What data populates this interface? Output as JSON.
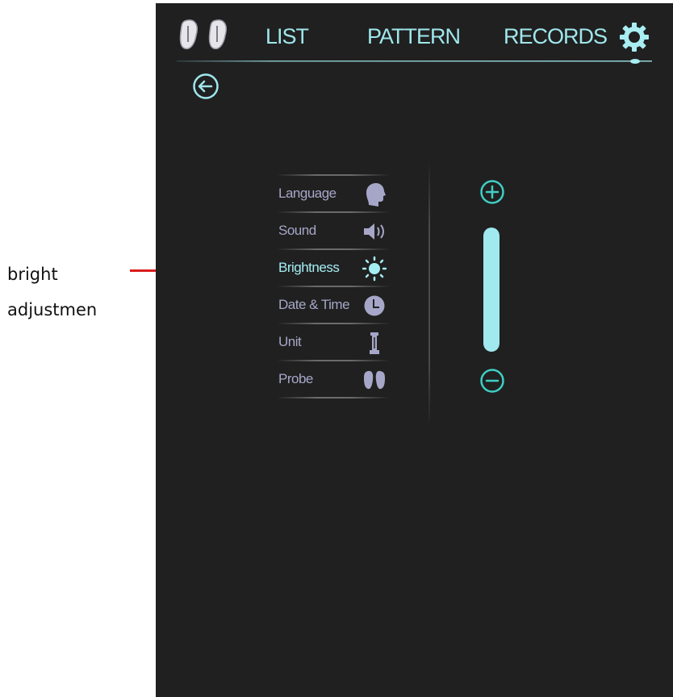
{
  "annotation": {
    "lines": [
      "bright",
      "adjustmen"
    ],
    "pointer_color": "#d91c1c"
  },
  "header": {
    "logo_icon": "probe-pair-icon",
    "tabs": [
      {
        "label": "LIST"
      },
      {
        "label": "PATTERN"
      },
      {
        "label": "RECORDS"
      }
    ],
    "settings_icon": "gear-icon",
    "back_icon": "back-arrow-icon"
  },
  "settings_menu": {
    "items": [
      {
        "label": "Language",
        "icon": "head-icon",
        "active": false
      },
      {
        "label": "Sound",
        "icon": "speaker-icon",
        "active": false
      },
      {
        "label": "Brightness",
        "icon": "sun-icon",
        "active": true
      },
      {
        "label": "Date & Time",
        "icon": "clock-icon",
        "active": false
      },
      {
        "label": "Unit",
        "icon": "unit-icon",
        "active": false
      },
      {
        "label": "Probe",
        "icon": "probe-icon",
        "active": false
      }
    ]
  },
  "brightness": {
    "level": 1.0,
    "increase_icon": "plus-circle-icon",
    "decrease_icon": "minus-circle-icon"
  },
  "colors": {
    "accent": "#9fe7ec",
    "screen_bg": "#202020",
    "menu_text": "#a6a7c8",
    "active_text": "#a5eef4"
  }
}
